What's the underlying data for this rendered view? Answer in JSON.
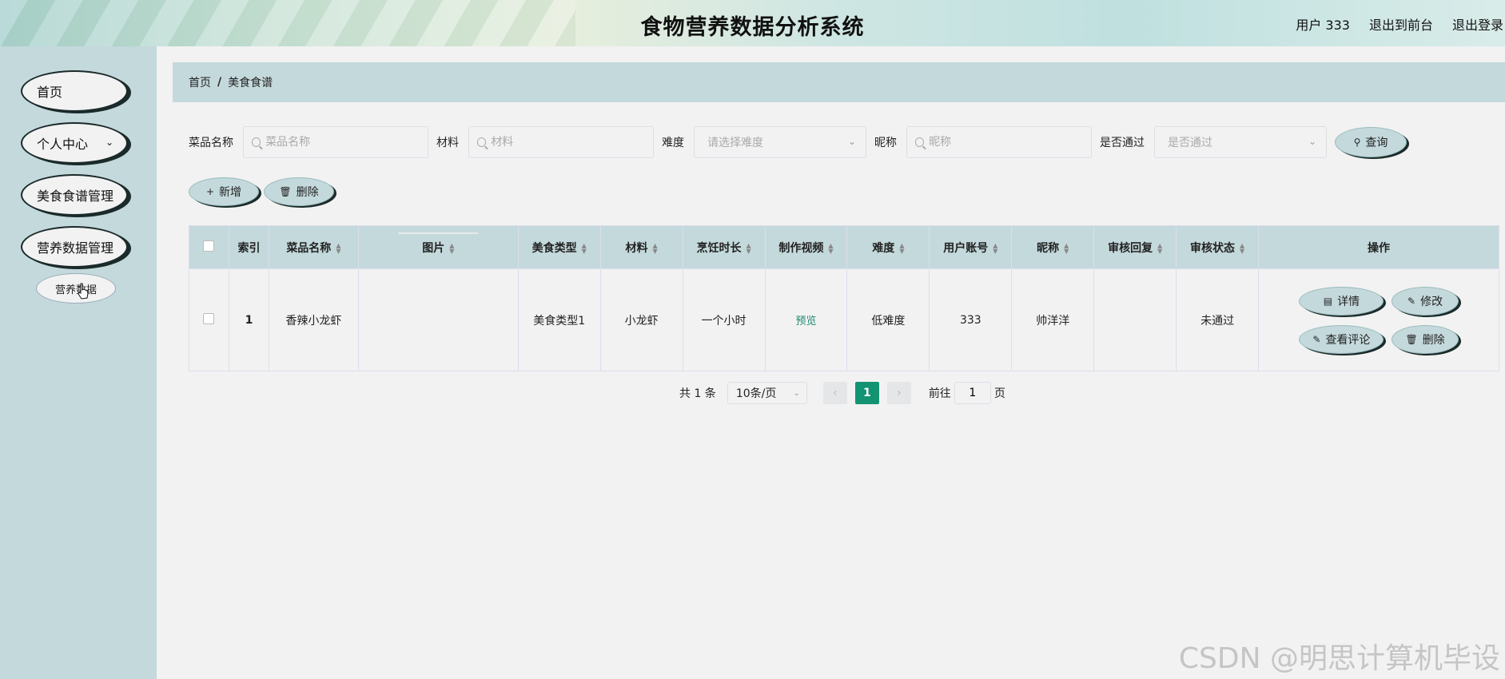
{
  "header": {
    "title": "食物营养数据分析系统",
    "user": "用户 333",
    "front": "退出到前台",
    "logout": "退出登录"
  },
  "sidebar": {
    "items": [
      {
        "label": "首页"
      },
      {
        "label": "个人中心"
      },
      {
        "label": "美食食谱管理"
      },
      {
        "label": "营养数据管理"
      }
    ],
    "submenu": "营养数据"
  },
  "breadcrumb": {
    "home": "首页",
    "sep": "/",
    "current": "美食食谱"
  },
  "search": {
    "name_label": "菜品名称",
    "name_placeholder": "菜品名称",
    "material_label": "材料",
    "material_placeholder": "材料",
    "difficulty_label": "难度",
    "difficulty_placeholder": "请选择难度",
    "nickname_label": "昵称",
    "nickname_placeholder": "昵称",
    "approved_label": "是否通过",
    "approved_placeholder": "是否通过",
    "query": "查询"
  },
  "toolbar": {
    "add": "新增",
    "delete": "删除"
  },
  "table": {
    "headers": [
      "索引",
      "菜品名称",
      "图片",
      "美食类型",
      "材料",
      "烹饪时长",
      "制作视频",
      "难度",
      "用户账号",
      "昵称",
      "审核回复",
      "审核状态",
      "操作"
    ],
    "row": {
      "index": "1",
      "name": "香辣小龙虾",
      "image": "",
      "type": "美食类型1",
      "material": "小龙虾",
      "duration": "一个小时",
      "video": "预览",
      "difficulty": "低难度",
      "account": "333",
      "nickname": "帅洋洋",
      "reply": "",
      "status": "未通过"
    },
    "actions": {
      "detail": "详情",
      "edit": "修改",
      "comments": "查看评论",
      "delete": "删除"
    }
  },
  "pagination": {
    "total": "共 1 条",
    "page_size": "10条/页",
    "current": "1",
    "goto_label": "前往",
    "goto_value": "1",
    "page_unit": "页"
  },
  "watermark": "CSDN @明思计算机毕设"
}
